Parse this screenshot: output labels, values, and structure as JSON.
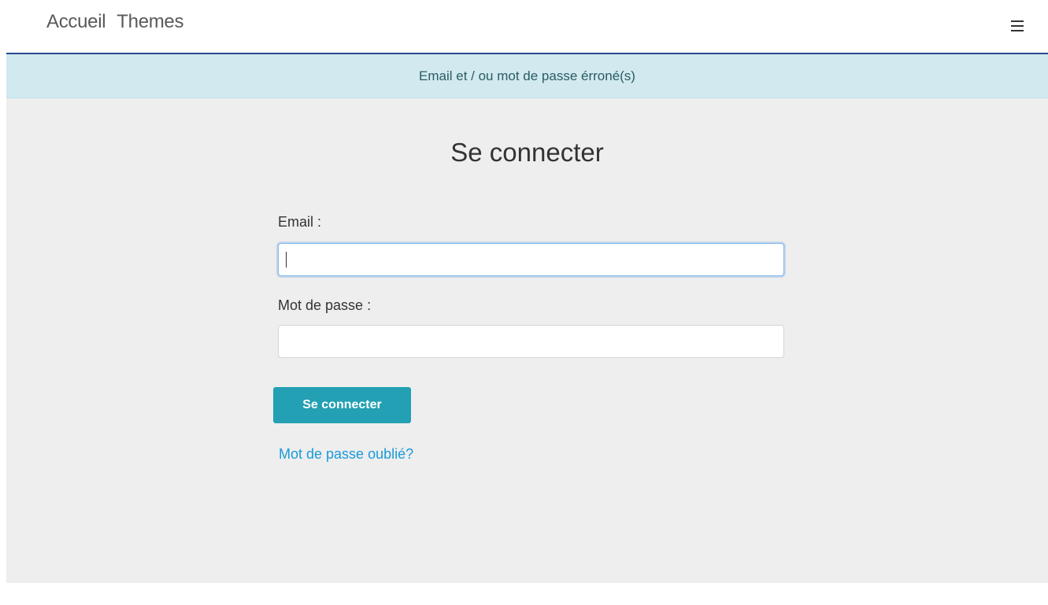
{
  "nav": {
    "links": [
      "Accueil",
      "Themes"
    ],
    "menu_icon": "hamburger-icon"
  },
  "alert": {
    "message": "Email et / ou mot de passe érroné(s)"
  },
  "form": {
    "title": "Se connecter",
    "email_label": "Email :",
    "email_value": "",
    "password_label": "Mot de passe :",
    "password_value": "",
    "submit_label": "Se connecter",
    "forgot_link": "Mot de passe oublié?"
  },
  "colors": {
    "alert_bg": "#d1e9ef",
    "button_bg": "#23a0b3",
    "link": "#1a9ad9"
  }
}
